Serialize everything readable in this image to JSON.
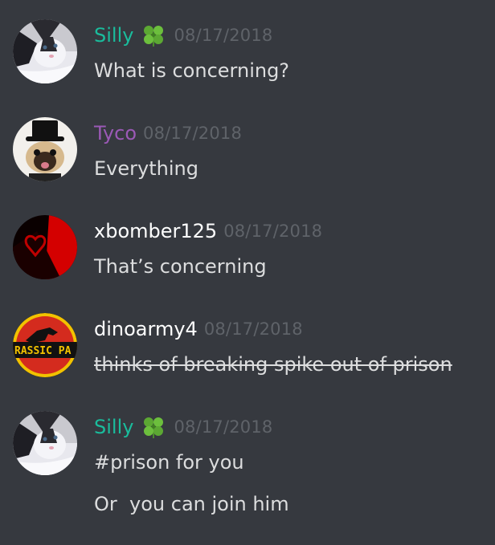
{
  "colors": {
    "background": "#36393f",
    "message_text": "#dcddde",
    "timestamp": "#5f6369",
    "role_teal": "#1abc9c",
    "role_purple": "#9b59b6",
    "role_white": "#ffffff"
  },
  "messages": [
    {
      "username": "Silly",
      "username_color": "#1abc9c",
      "badge_icon": "four-leaf-clover-icon",
      "timestamp": "08/17/2018",
      "avatar": "cat-avatar",
      "lines": [
        "What is concerning?"
      ]
    },
    {
      "username": "Tyco",
      "username_color": "#9b59b6",
      "timestamp": "08/17/2018",
      "avatar": "pug-top-hat-avatar",
      "lines": [
        "Everything"
      ]
    },
    {
      "username": "xbomber125",
      "username_color": "#ffffff",
      "timestamp": "08/17/2018",
      "avatar": "red-heart-avatar",
      "lines": [
        "That’s concerning"
      ]
    },
    {
      "username": "dinoarmy4",
      "username_color": "#ffffff",
      "timestamp": "08/17/2018",
      "avatar": "jurassic-park-logo-avatar",
      "avatar_text": "RASSIC PA",
      "lines": [
        "thinks of breaking spike out of prison"
      ],
      "strikethrough": true
    },
    {
      "username": "Silly",
      "username_color": "#1abc9c",
      "badge_icon": "four-leaf-clover-icon",
      "timestamp": "08/17/2018",
      "avatar": "cat-avatar",
      "lines": [
        "#prison for you",
        "Or  you can join him"
      ]
    }
  ]
}
